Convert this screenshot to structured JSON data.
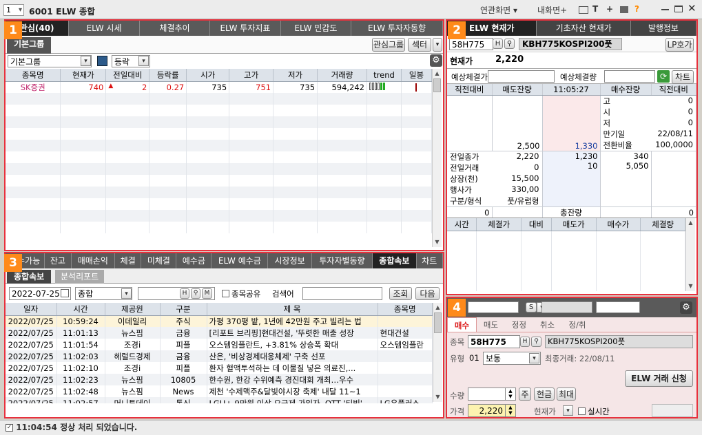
{
  "titlebar": {
    "window_num": "1",
    "title": "6001 ELW 종합",
    "related": "연관화면",
    "naeHwamyeon": "내화면+",
    "icons": [
      "monitor-icon",
      "text-icon",
      "plus-icon",
      "print-icon",
      "help-icon"
    ],
    "help": "?",
    "help_color": "#ff8a00"
  },
  "badges": {
    "p1": "1",
    "p2": "2",
    "p3": "3",
    "p4": "4"
  },
  "panel1": {
    "tabs": [
      "관심(40)",
      "ELW 시세",
      "체결추이",
      "ELW 투자지표",
      "ELW 민감도",
      "ELW 투자자동향"
    ],
    "subtab": "기본그룹",
    "btn_group": "관심그룹",
    "btn_sector": "섹터",
    "group_select": "기본그룹",
    "sort_select": "등락",
    "columns": [
      "종목명",
      "현재가",
      "전일대비",
      "등락률",
      "시가",
      "고가",
      "저가",
      "거래량",
      "trend",
      "일봉"
    ],
    "row": {
      "name": "SK증권",
      "price": "740",
      "change_sign": "▲",
      "change": "2",
      "rate": "0.27",
      "open": "735",
      "high": "751",
      "low": "735",
      "volume": "594,242"
    }
  },
  "panel2": {
    "tabs": [
      "ELW 현재가",
      "기초자산 현재가",
      "발행정보"
    ],
    "code": "58H775",
    "name": "KBH775KOSPI200풋",
    "lp_btn": "LP호가",
    "cur_label": "현재가",
    "cur_value": "2,220",
    "exp_price_label": "예상체결가",
    "exp_qty_label": "예상체결량",
    "chart_btn": "차트",
    "ob_headers": [
      "직전대비",
      "매도잔량",
      "11:05:27",
      "매수잔량",
      "직전대비"
    ],
    "right_info": [
      [
        "고",
        "0"
      ],
      [
        "시",
        "0"
      ],
      [
        "저",
        "0"
      ],
      [
        "만기일",
        "22/08/11"
      ],
      [
        "전환비율",
        "100,0000"
      ]
    ],
    "ask_qty": "2,500",
    "ask_price": "1,330",
    "bid_price": "1,230",
    "bid_price2": "10",
    "bid_qty": "340",
    "bid_qty2": "5,050",
    "left_info": [
      [
        "전일종가",
        "2,220"
      ],
      [
        "전일거래",
        "0"
      ],
      [
        "상장(천)",
        "15,500"
      ],
      [
        "행사가",
        "330,00"
      ],
      [
        "구분/형식",
        "풋/유럽형"
      ]
    ],
    "total_left": "0",
    "total_label": "총잔량",
    "total_right": "0",
    "trade_cols": [
      "시간",
      "체결가",
      "대비",
      "매도가",
      "매수가",
      "체결량"
    ]
  },
  "panel3": {
    "tabs": [
      "매수가능",
      "잔고",
      "매매손익",
      "체결",
      "미체결",
      "예수금",
      "ELW 예수금",
      "시장정보",
      "투자자별동향",
      "종합속보",
      "차트"
    ],
    "subtabs": [
      "종합속보",
      "분석리포트"
    ],
    "date": "2022-07-25",
    "category": "종합",
    "share_label": "종목공유",
    "search_label": "검색어",
    "btn_search": "조회",
    "btn_next": "다음",
    "columns": [
      "일자",
      "시간",
      "제공원",
      "구분",
      "제 목",
      "종목명"
    ],
    "rows": [
      [
        "2022/07/25",
        "10:59:24",
        "이데일리",
        "주식",
        "가평 370평 밭, 1년에 42만원 주고 빌리는 법",
        ""
      ],
      [
        "2022/07/25",
        "11:01:13",
        "뉴스핌",
        "금융",
        "[리포트 브리핑]현대건설, '뚜렷한 매출 성장",
        "현대건설"
      ],
      [
        "2022/07/25",
        "11:01:54",
        "조경i",
        "피플",
        "오스템임플란트, +3.81% 상승폭 확대",
        "오스템임플란"
      ],
      [
        "2022/07/25",
        "11:02:03",
        "헤럴드경제",
        "금융",
        "산은, '비상경제대응체제' 구축 선포",
        ""
      ],
      [
        "2022/07/25",
        "11:02:10",
        "조경i",
        "피플",
        "환자 혈액투석하는 데 이물질 넣은 의료진,...",
        ""
      ],
      [
        "2022/07/25",
        "11:02:23",
        "뉴스핌",
        "10805",
        "한수원, 한강 수위예측 경진대회 개최…우수",
        ""
      ],
      [
        "2022/07/25",
        "11:02:48",
        "뉴스핌",
        "News",
        "제천 '수제맥주&달빛야시장 축제' 내달 11~1",
        ""
      ],
      [
        "2022/07/25",
        "11:02:57",
        "머니투데이",
        "통신",
        "LGU+ 9만원 이상 요금제 가입자, OTT '티빙'",
        "LG유플러스"
      ]
    ]
  },
  "panel4": {
    "tabs": [
      "매수",
      "매도",
      "정정",
      "취소",
      "정/취"
    ],
    "code_label": "종목",
    "code": "58H775",
    "name": "KBH775KOSPI200풋",
    "type_label": "유형",
    "type_code": "01",
    "type_value": "보통",
    "last_trade": "최종거래: 22/08/11",
    "apply_btn": "ELW 거래 신청",
    "qty_label": "수량",
    "qty_unit": "주",
    "btn_cash": "현금",
    "btn_max": "최대",
    "price_label": "가격",
    "price_value": "2,220",
    "price_type": "현재가",
    "realtime": "실시간",
    "s_label": "S"
  },
  "status": {
    "time": "11:04:54",
    "message": "정상 처리 되었습니다."
  },
  "colors": {
    "accent_border": "#e8313d",
    "badge": "#ff8a1a",
    "up": "#d11",
    "tab_dark": "#5a5a5a"
  }
}
